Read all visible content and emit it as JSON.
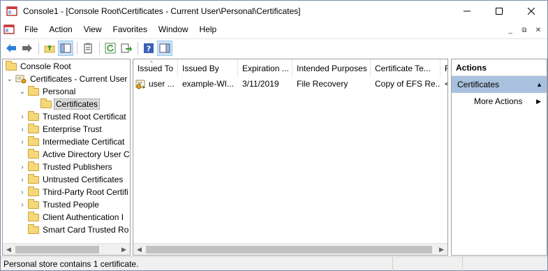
{
  "window": {
    "title": "Console1 - [Console Root\\Certificates - Current User\\Personal\\Certificates]",
    "controls": {
      "minimize": "—",
      "maximize": "☐",
      "close": "✕"
    }
  },
  "menu": {
    "items": [
      "File",
      "Action",
      "View",
      "Favorites",
      "Window",
      "Help"
    ],
    "mdi": {
      "minimize": "_",
      "restore": "⧉",
      "close": "✕"
    }
  },
  "toolbar": {
    "buttons": [
      "back-arrow-icon",
      "forward-arrow-icon",
      "up-folder-icon",
      "show-hide-tree-icon",
      "properties-icon",
      "refresh-icon",
      "export-list-icon",
      "help-icon",
      "show-hide-action-pane-icon"
    ]
  },
  "tree": {
    "nodes": [
      {
        "label": "Console Root",
        "expander": "",
        "icon": "folder-icon"
      },
      {
        "label": "Certificates - Current User",
        "expander": "⌄",
        "icon": "certificates-snapin-icon"
      },
      {
        "label": "Personal",
        "expander": "⌄",
        "icon": "folder-icon"
      },
      {
        "label": "Certificates",
        "expander": "",
        "icon": "folder-icon",
        "selected": true
      },
      {
        "label": "Trusted Root Certificat",
        "expander": "›",
        "icon": "folder-icon"
      },
      {
        "label": "Enterprise Trust",
        "expander": "›",
        "icon": "folder-icon"
      },
      {
        "label": "Intermediate Certificat",
        "expander": "›",
        "icon": "folder-icon"
      },
      {
        "label": "Active Directory User C",
        "expander": "",
        "icon": "folder-icon"
      },
      {
        "label": "Trusted Publishers",
        "expander": "›",
        "icon": "folder-icon"
      },
      {
        "label": "Untrusted Certificates",
        "expander": "›",
        "icon": "folder-icon"
      },
      {
        "label": "Third-Party Root Certifi",
        "expander": "›",
        "icon": "folder-icon"
      },
      {
        "label": "Trusted People",
        "expander": "›",
        "icon": "folder-icon"
      },
      {
        "label": "Client Authentication I",
        "expander": "",
        "icon": "folder-icon"
      },
      {
        "label": "Smart Card Trusted Ro",
        "expander": "",
        "icon": "folder-icon"
      }
    ]
  },
  "list": {
    "columns": [
      "Issued To",
      "Issued By",
      "Expiration ...",
      "Intended Purposes",
      "Certificate Te...",
      "F"
    ],
    "sort_indicator": "^",
    "rows": [
      [
        "user ...",
        "example-WI...",
        "3/11/2019",
        "File Recovery",
        "Copy of EFS Re...",
        "<"
      ]
    ]
  },
  "actions": {
    "title": "Actions",
    "section": "Certificates",
    "section_arrow": "▲",
    "items": [
      {
        "label": "More Actions",
        "arrow": "▶"
      }
    ]
  },
  "status": {
    "text": "Personal store contains 1 certificate."
  },
  "scroll": {
    "left": "◀",
    "right": "▶"
  },
  "colors": {
    "section_bg": "#a9c0de",
    "selected_bg": "#d9d9d9",
    "folder": "#f6d878",
    "toolbar_pressed": "#cce4f7"
  }
}
